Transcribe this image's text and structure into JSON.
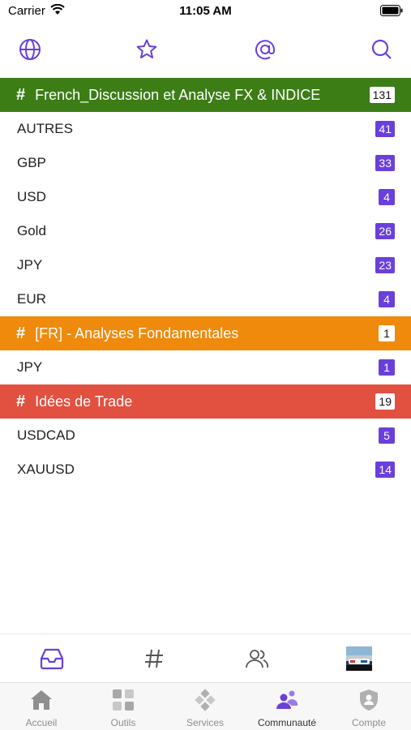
{
  "status_bar": {
    "carrier": "Carrier",
    "time": "11:05 AM"
  },
  "accent_color": "#6a3fdc",
  "top_toolbar": {
    "icons": [
      "globe-icon",
      "star-icon",
      "at-icon",
      "search-icon"
    ]
  },
  "groups": [
    {
      "title": "French_Discussion et Analyse FX & INDICE",
      "count": "131",
      "color": "#3c7d16",
      "channels": [
        {
          "name": "AUTRES",
          "count": "41"
        },
        {
          "name": "GBP",
          "count": "33"
        },
        {
          "name": "USD",
          "count": "4"
        },
        {
          "name": "Gold",
          "count": "26"
        },
        {
          "name": "JPY",
          "count": "23"
        },
        {
          "name": "EUR",
          "count": "4"
        }
      ]
    },
    {
      "title": "[FR] - Analyses Fondamentales",
      "count": "1",
      "color": "#ef8a0c",
      "channels": [
        {
          "name": "JPY",
          "count": "1"
        }
      ]
    },
    {
      "title": "Idées de Trade",
      "count": "19",
      "color": "#e25040",
      "channels": [
        {
          "name": "USDCAD",
          "count": "5"
        },
        {
          "name": "XAUUSD",
          "count": "14"
        }
      ]
    }
  ],
  "sub_tabbar": {
    "icons": [
      "inbox-icon",
      "hashtag-icon",
      "users-icon",
      "avatar"
    ]
  },
  "main_tabbar": {
    "tabs": [
      {
        "label": "Accueil",
        "icon": "home-icon"
      },
      {
        "label": "Outils",
        "icon": "grid-icon"
      },
      {
        "label": "Services",
        "icon": "diamond-icon"
      },
      {
        "label": "Communauté",
        "icon": "community-icon",
        "active": true
      },
      {
        "label": "Compte",
        "icon": "shield-icon"
      }
    ]
  }
}
